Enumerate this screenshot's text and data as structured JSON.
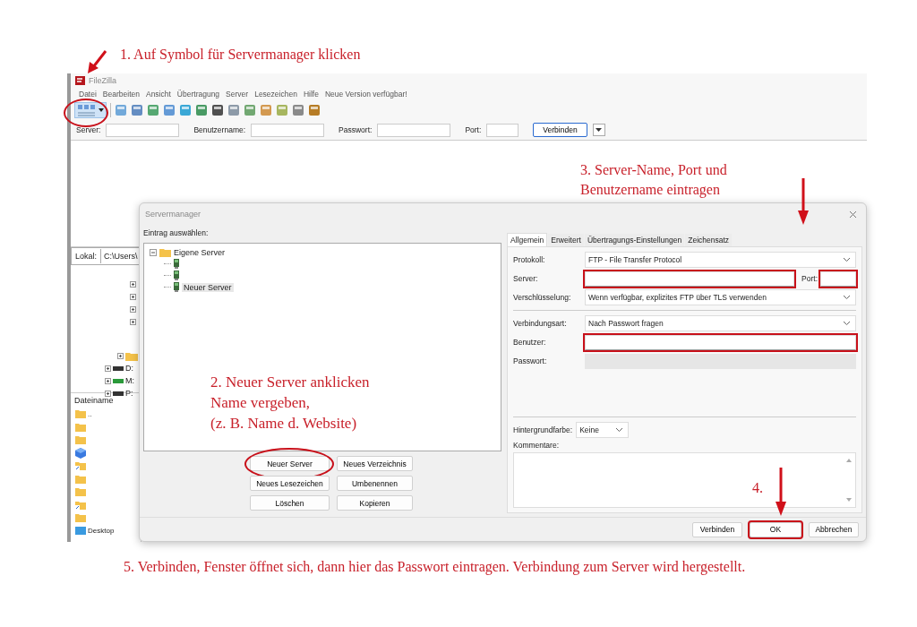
{
  "steps": [
    {
      "text": "1. Auf Symbol für Servermanager klicken"
    },
    {
      "text": "2. Neuer Server anklicken\nName vergeben,\n(z. B. Name d. Website)"
    },
    {
      "text": "3. Server-Name, Port und\nBenutzername eintragen"
    },
    {
      "text": "4."
    },
    {
      "text": "5. Verbinden, Fenster öffnet sich, dann hier das Passwort eintragen. Verbindung zum Server wird hergestellt."
    }
  ],
  "app": {
    "title": "FileZilla",
    "menu": [
      "Datei",
      "Bearbeiten",
      "Ansicht",
      "Übertragung",
      "Server",
      "Lesezeichen",
      "Hilfe",
      "Neue Version verfügbar!"
    ],
    "toolbar": {
      "sitemanager_circled": true
    },
    "quickconnect": {
      "fields": [
        "Server:",
        "Benutzername:",
        "Passwort:",
        "Port:"
      ],
      "button": "Verbinden"
    },
    "local": {
      "label": "Lokal:",
      "path": "C:\\Users\\",
      "drives": [
        {
          "label": "D:",
          "kind": "disk"
        },
        {
          "label": "M:",
          "kind": "network"
        },
        {
          "label": "P:",
          "kind": "disk"
        }
      ],
      "column": "Dateiname",
      "files": [
        {
          "kind": "folder",
          "name": ".."
        },
        {
          "kind": "folder"
        },
        {
          "kind": "folder"
        },
        {
          "kind": "package"
        },
        {
          "kind": "shortcut"
        },
        {
          "kind": "folder"
        },
        {
          "kind": "folder"
        },
        {
          "kind": "shortcut"
        },
        {
          "kind": "folder"
        },
        {
          "kind": "desktop",
          "name": "Desktop"
        }
      ]
    }
  },
  "dialog": {
    "title": "Servermanager",
    "select_label": "Eintrag auswählen:",
    "tree": {
      "label": "Eigene Server",
      "expanded": true,
      "children": [
        {
          "kind": "server",
          "selected": false
        },
        {
          "kind": "server",
          "selected": false
        },
        {
          "kind": "server",
          "label": "Neuer Server",
          "selected": true
        }
      ]
    },
    "tree_buttons": [
      {
        "label": "Neuer Server",
        "circled": true
      },
      {
        "label": "Neues Verzeichnis",
        "circled": false
      },
      {
        "label": "Neues Lesezeichen",
        "circled": false
      },
      {
        "label": "Umbenennen",
        "circled": false
      },
      {
        "label": "Löschen",
        "circled": false
      },
      {
        "label": "Kopieren",
        "circled": false
      }
    ],
    "tabs": [
      {
        "label": "Allgemein",
        "selected": true
      },
      {
        "label": "Erweitert",
        "selected": false
      },
      {
        "label": "Übertragungs-Einstellungen",
        "selected": false
      },
      {
        "label": "Zeichensatz",
        "selected": false
      }
    ],
    "rows": [
      {
        "kind": "select",
        "label": "Protokoll:",
        "value": "FTP - File Transfer Protocol"
      },
      {
        "kind": "text",
        "label": "Server:",
        "highlighted": true,
        "disabled": false,
        "port": {
          "label": "Port:",
          "highlighted": true
        }
      },
      {
        "kind": "select",
        "label": "Verschlüsselung:",
        "value": "Wenn verfügbar, explizites FTP über TLS verwenden"
      },
      {
        "kind": "divider"
      },
      {
        "kind": "select",
        "label": "Verbindungsart:",
        "value": "Nach Passwort fragen"
      },
      {
        "kind": "text",
        "label": "Benutzer:",
        "highlighted": true,
        "disabled": false
      },
      {
        "kind": "text",
        "label": "Passwort:",
        "highlighted": false,
        "disabled": true
      }
    ],
    "background": {
      "label": "Hintergrundfarbe:",
      "value": "Keine"
    },
    "comments": {
      "label": "Kommentare:"
    },
    "footer_buttons": [
      {
        "label": "Verbinden",
        "highlighted": false
      },
      {
        "label": "OK",
        "highlighted": true
      },
      {
        "label": "Abbrechen",
        "highlighted": false
      }
    ]
  }
}
